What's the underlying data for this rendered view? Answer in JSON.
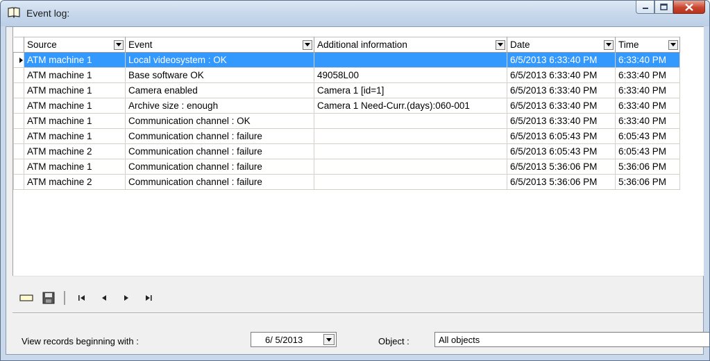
{
  "window": {
    "title": "Event log:"
  },
  "grid": {
    "columns": [
      {
        "label": "Source",
        "has_dropdown": true
      },
      {
        "label": "Event",
        "has_dropdown": true
      },
      {
        "label": "Additional information",
        "has_dropdown": true
      },
      {
        "label": "Date",
        "has_dropdown": true
      },
      {
        "label": "Time",
        "has_dropdown": true
      }
    ],
    "rows": [
      {
        "source": "ATM machine 1",
        "event": "Local videosystem : OK",
        "info": "",
        "date": "6/5/2013 6:33:40 PM",
        "time": "6:33:40 PM",
        "selected": true
      },
      {
        "source": "ATM machine 1",
        "event": "Base software OK",
        "info": "49058L00",
        "date": "6/5/2013 6:33:40 PM",
        "time": "6:33:40 PM"
      },
      {
        "source": "ATM machine 1",
        "event": "Camera enabled",
        "info": "Camera 1 [id=1]",
        "date": "6/5/2013 6:33:40 PM",
        "time": "6:33:40 PM"
      },
      {
        "source": "ATM machine 1",
        "event": "Archive size : enough",
        "info": "Camera 1 Need-Curr.(days):060-001",
        "date": "6/5/2013 6:33:40 PM",
        "time": "6:33:40 PM"
      },
      {
        "source": "ATM machine 1",
        "event": "Communication channel : OK",
        "info": "",
        "date": "6/5/2013 6:33:40 PM",
        "time": "6:33:40 PM"
      },
      {
        "source": "ATM machine 1",
        "event": "Communication channel : failure",
        "info": "",
        "date": "6/5/2013 6:05:43 PM",
        "time": "6:05:43 PM"
      },
      {
        "source": "ATM machine 2",
        "event": "Communication channel : failure",
        "info": "",
        "date": "6/5/2013 6:05:43 PM",
        "time": "6:05:43 PM"
      },
      {
        "source": "ATM machine 1",
        "event": "Communication channel : failure",
        "info": "",
        "date": "6/5/2013 5:36:06 PM",
        "time": "5:36:06 PM"
      },
      {
        "source": "ATM machine 2",
        "event": "Communication channel : failure",
        "info": "",
        "date": "6/5/2013 5:36:06 PM",
        "time": "5:36:06 PM"
      }
    ]
  },
  "toolbar": {
    "buttons": [
      "new-record-icon",
      "save-icon",
      "first-record-icon",
      "previous-record-icon",
      "next-record-icon",
      "last-record-icon"
    ]
  },
  "filter": {
    "label": "View records beginning with :",
    "date_value": "6/ 5/2013",
    "object_label": "Object :",
    "object_value": "All objects"
  },
  "colors": {
    "selection": "#3399ff",
    "title_bar": "#c7d8ec",
    "close_button": "#c9452f"
  }
}
